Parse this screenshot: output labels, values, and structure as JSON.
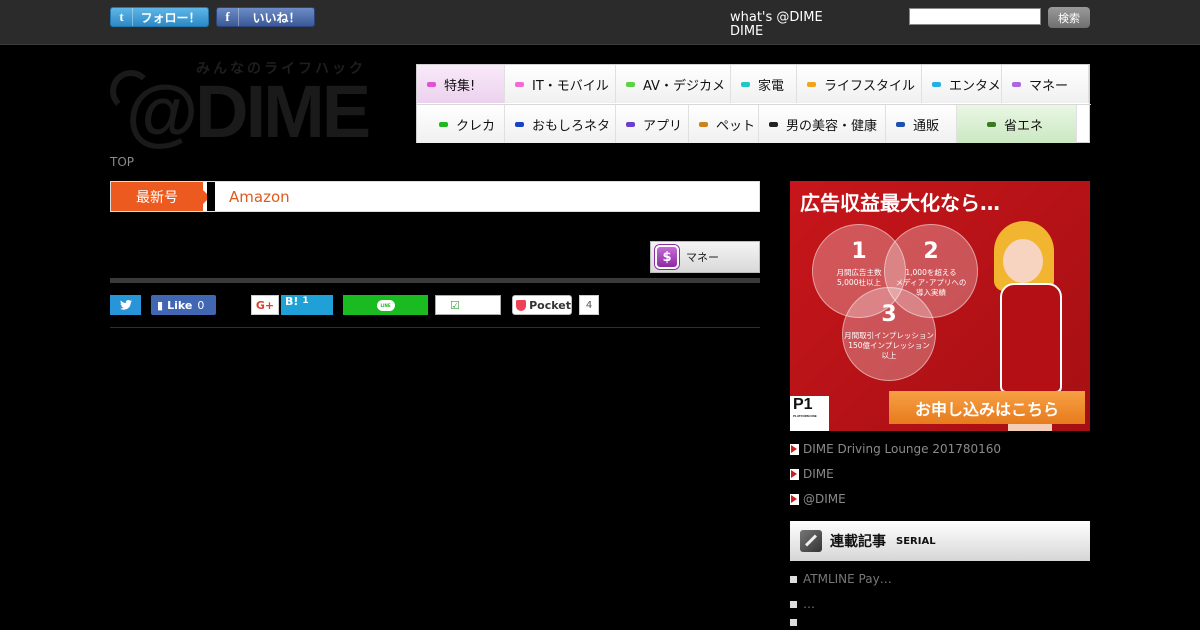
{
  "topbar": {
    "follow_label": "フォロー！",
    "follow_icon": "t",
    "like_label": "いいね！",
    "like_icon": "f",
    "whats_line1": "what's @DIME",
    "whats_line2": "DIME",
    "search_value": "",
    "search_button": "検索"
  },
  "logo": {
    "tagline": "みんなのライフハック",
    "text": "@DIME"
  },
  "nav": {
    "row1": [
      {
        "label": "特集!",
        "color": "#e051d6"
      },
      {
        "label": "IT・モバイル",
        "color": "#f06bd9"
      },
      {
        "label": "AV・デジカメ",
        "color": "#57d63e"
      },
      {
        "label": "家電",
        "color": "#23c7c2"
      },
      {
        "label": "ライフスタイル",
        "color": "#f2a31b"
      },
      {
        "label": "エンタメ",
        "color": "#22b0e6"
      },
      {
        "label": "マネー",
        "color": "#b065e0"
      }
    ],
    "row2": [
      {
        "label": "クレカ",
        "color": "#1fb81f"
      },
      {
        "label": "おもしろネタ",
        "color": "#1544c4"
      },
      {
        "label": "アプリ",
        "color": "#6a3fcf"
      },
      {
        "label": "ペット",
        "color": "#c9841c"
      },
      {
        "label": "男の美容・健康",
        "color": "#222222"
      },
      {
        "label": "通販",
        "color": "#1d4fb0"
      },
      {
        "label": "省エネ",
        "color": "#3a7a23"
      }
    ]
  },
  "breadcrumb": "TOP",
  "headline": {
    "tag": "最新号",
    "title": "Amazon"
  },
  "category_badge": {
    "icon": "$",
    "label": "マネー"
  },
  "share": {
    "fb_label": "Like",
    "fb_count": "0",
    "gplus_label": "G+",
    "hatena_label": "B!",
    "hatena_count": "1",
    "line_label": "LINE",
    "line_count": "☑",
    "pocket_label": "Pocket",
    "pocket_count": "4"
  },
  "ad": {
    "title": "広告収益最大化なら…",
    "c1_num": "1",
    "c1_text": "月間広告主数\n5,000社以上",
    "c2_num": "2",
    "c2_text": "1,000を超える\nメディア･アプリへの\n導入実績",
    "c3_num": "3",
    "c3_text": "月間取引インプレッション\n150億インプレッション\n以上",
    "cta": "お申し込みはこちら",
    "logo": "P1",
    "logo_sub": "PLATFORM ONE"
  },
  "side_links": [
    "DIME Driving Lounge 201780160",
    "DIME",
    "@DIME"
  ],
  "serial": {
    "title": "連載記事",
    "subtitle": "SERIAL",
    "items": [
      "ATMLINE Pay…",
      "…",
      ""
    ]
  }
}
